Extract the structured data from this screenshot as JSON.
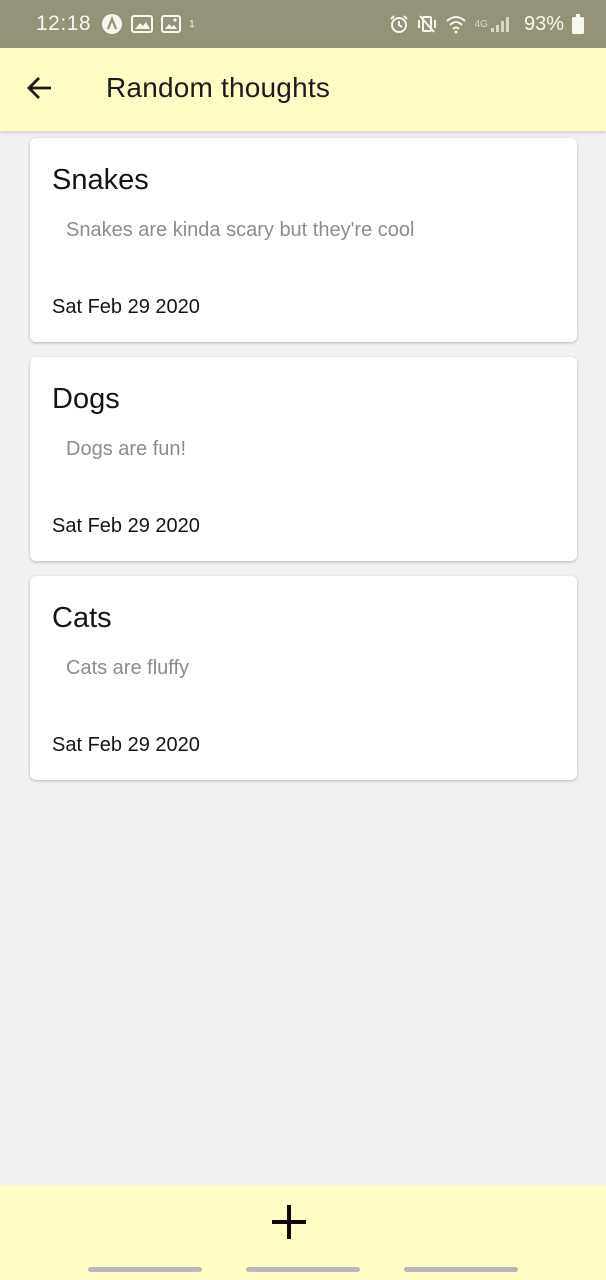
{
  "status_bar": {
    "time": "12:18",
    "notification_number": "1",
    "network_label": "4G",
    "battery_percent": "93%",
    "left_icons": [
      "app-a-icon",
      "gallery-icon",
      "image-icon",
      "notification-count"
    ],
    "right_icons": [
      "alarm-icon",
      "mute-vibrate-icon",
      "wifi-icon",
      "signal-icon",
      "battery-icon"
    ]
  },
  "app_bar": {
    "title": "Random thoughts",
    "back_icon": "arrow-left-icon",
    "background": "#fffdc4"
  },
  "notes": [
    {
      "title": "Snakes",
      "body": "Snakes are kinda scary but they're cool",
      "date": "Sat Feb 29 2020"
    },
    {
      "title": "Dogs",
      "body": "Dogs are fun!",
      "date": "Sat Feb 29 2020"
    },
    {
      "title": "Cats",
      "body": "Cats are fluffy",
      "date": "Sat Feb 29 2020"
    }
  ],
  "bottom_bar": {
    "add_icon": "plus-icon",
    "background": "#fffdc4"
  },
  "colors": {
    "status_bar": "#949277",
    "page_background": "#f1f1f1",
    "card_background": "#ffffff",
    "note_body_text": "#8c8c8c"
  }
}
